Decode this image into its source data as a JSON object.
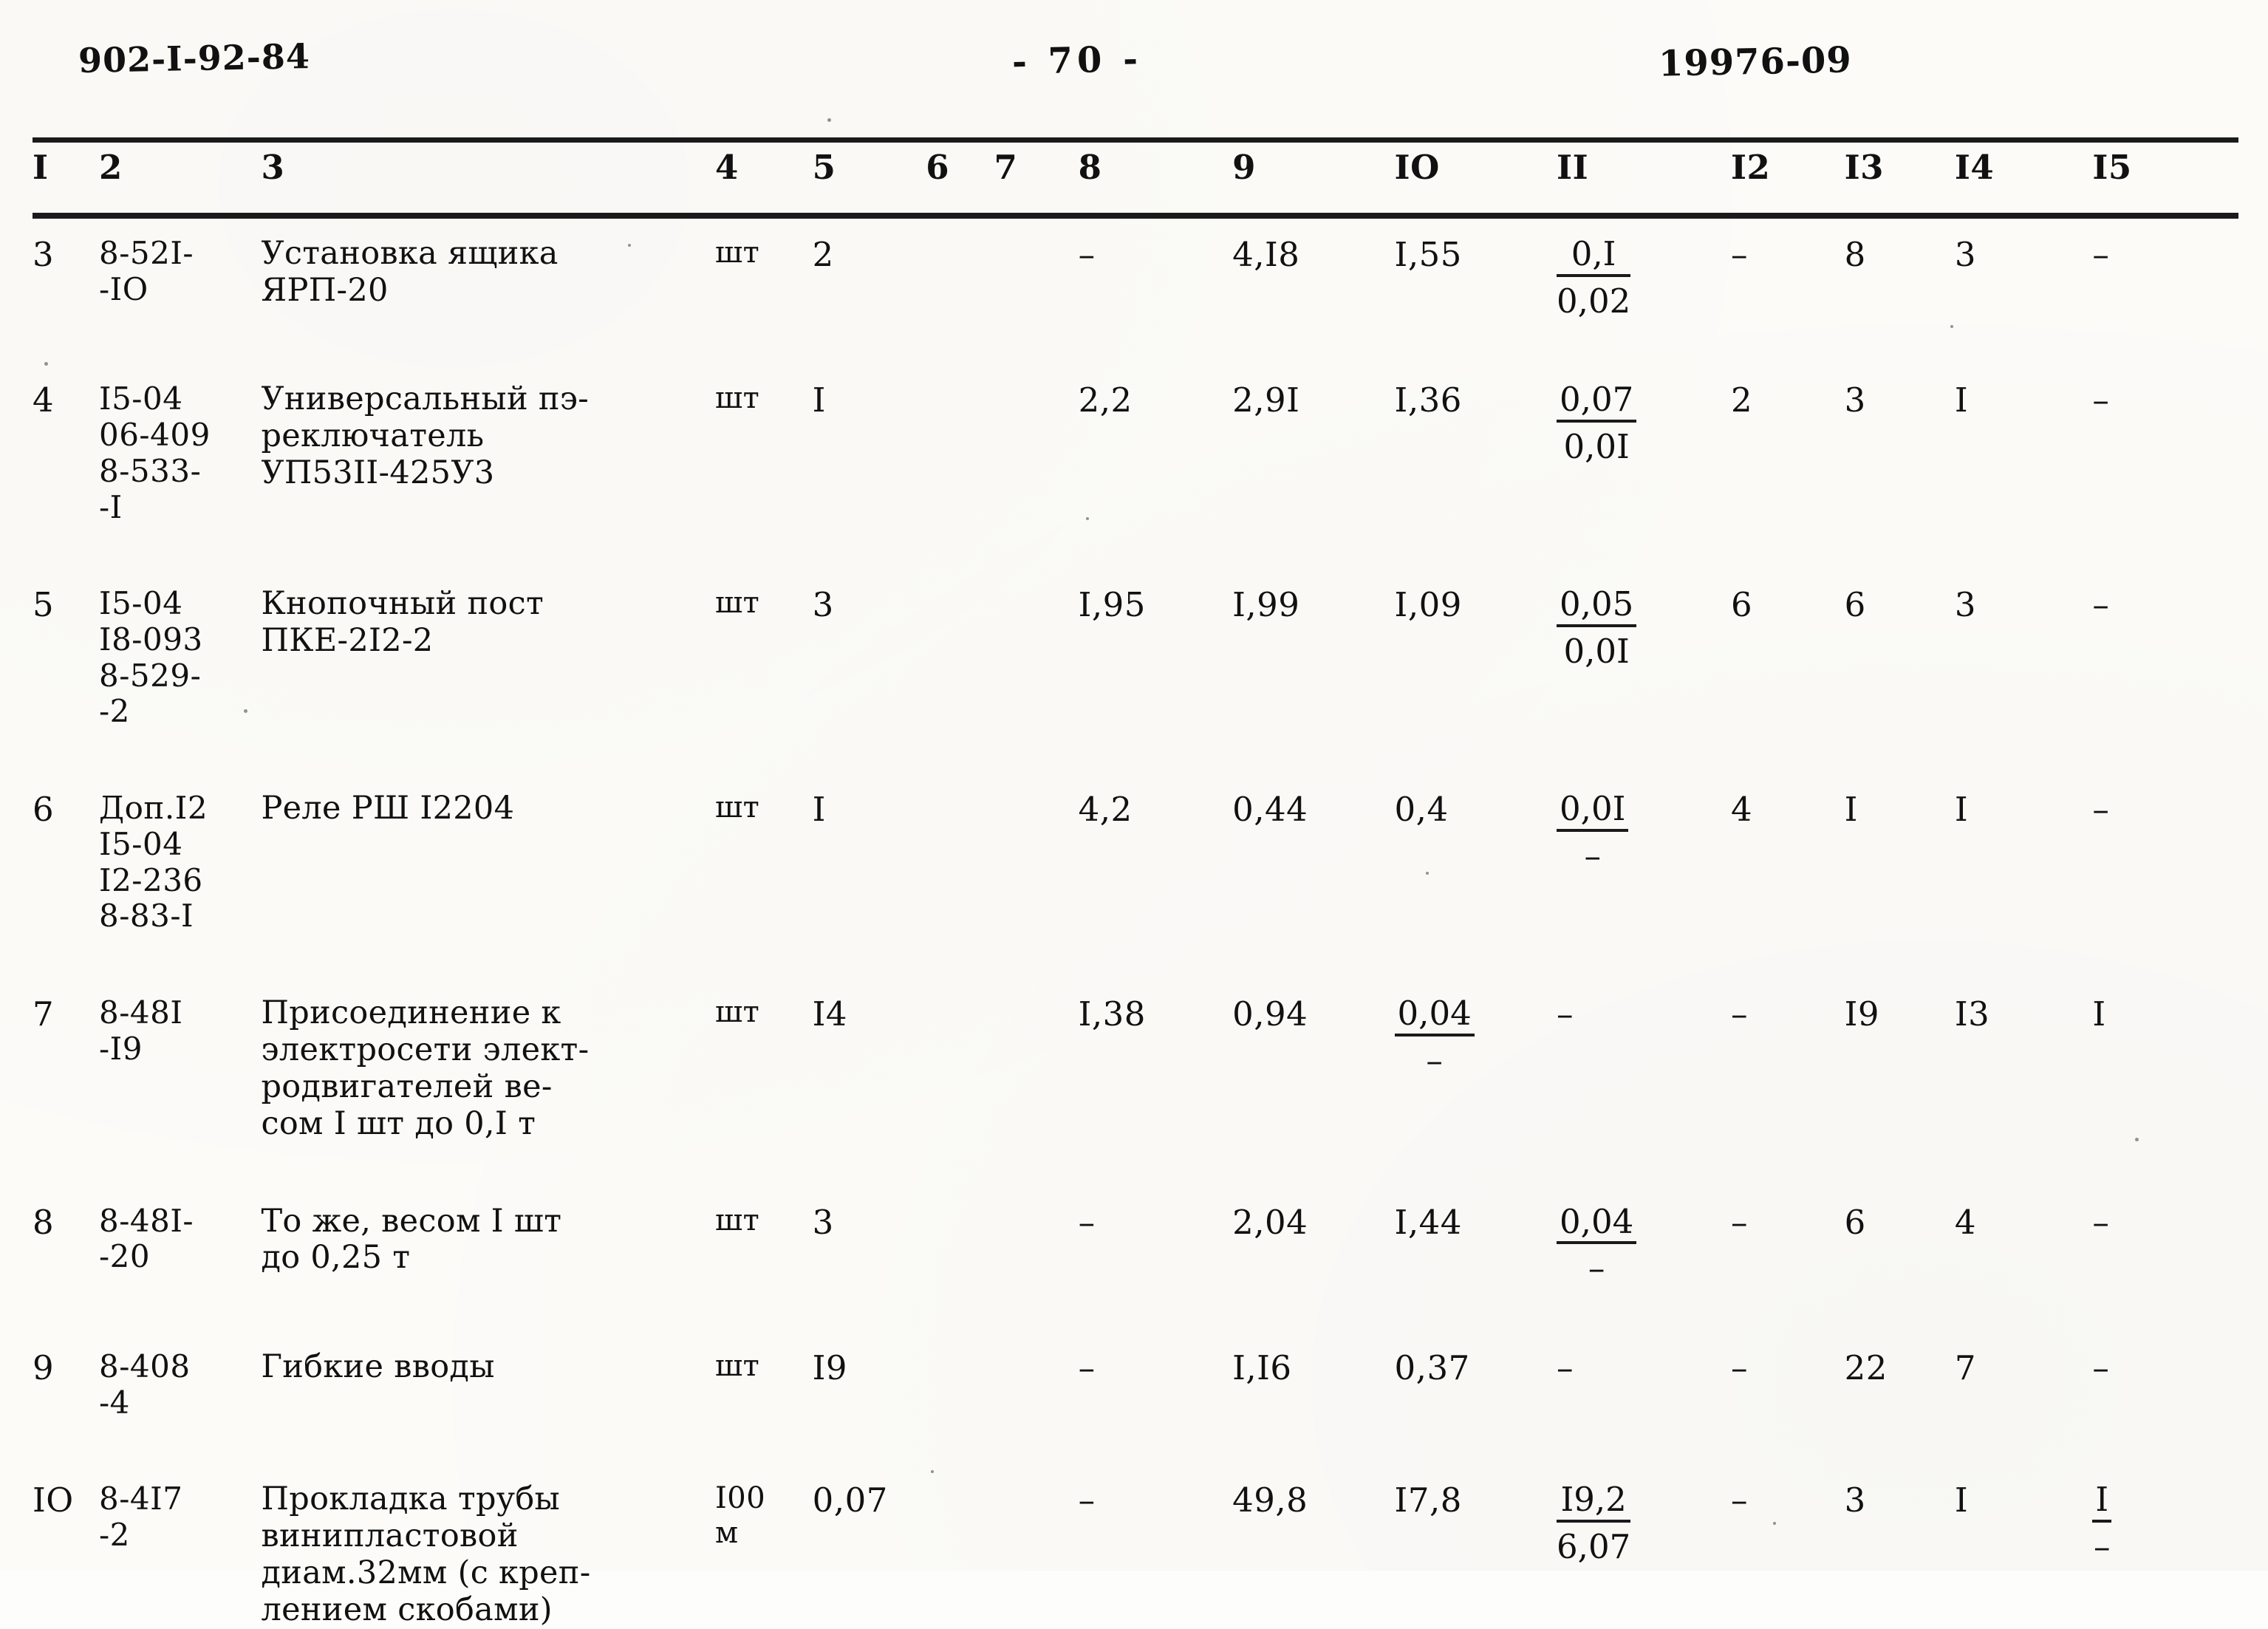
{
  "header": {
    "doc_number": "902-I-92-84",
    "page_marker": "- 70 -",
    "sheet_code": "19976-09"
  },
  "table": {
    "column_headers": [
      "I",
      "2",
      "3",
      "4",
      "5",
      "6",
      "7",
      "8",
      "9",
      "IO",
      "II",
      "I2",
      "I3",
      "I4",
      "I5"
    ],
    "rows": [
      {
        "pos": "3",
        "code": "8-52I-\n-IO",
        "name": "Установка ящика\nЯРП-20",
        "unit": "шт",
        "c5": "2",
        "c6": "",
        "c7": "",
        "c8": "–",
        "c9": "4,I8",
        "c10": "I,55",
        "c11_numer": "0,I",
        "c11_denom": "0,02",
        "c12": "–",
        "c13": "8",
        "c14": "3",
        "c15": "–"
      },
      {
        "pos": "4",
        "code": "I5-04\n06-409\n8-533-\n-I",
        "name": "Универсальный пэ-\nреключатель\nУП53II-425У3",
        "unit": "шт",
        "c5": "I",
        "c6": "",
        "c7": "",
        "c8": "2,2",
        "c9": "2,9I",
        "c10": "I,36",
        "c11_numer": "0,07",
        "c11_denom": "0,0I",
        "c12": "2",
        "c13": "3",
        "c14": "I",
        "c15": "–"
      },
      {
        "pos": "5",
        "code": "I5-04\nI8-093\n8-529-\n-2",
        "name": "Кнопочный пост\nПКЕ-2I2-2",
        "unit": "шт",
        "c5": "3",
        "c6": "",
        "c7": "",
        "c8": "I,95",
        "c9": "I,99",
        "c10": "I,09",
        "c11_numer": "0,05",
        "c11_denom": "0,0I",
        "c12": "6",
        "c13": "6",
        "c14": "3",
        "c15": "–"
      },
      {
        "pos": "6",
        "code": "Доп.I2\nI5-04\nI2-236\n8-83-I",
        "name": "Реле РШ I2204",
        "unit": "шт",
        "c5": "I",
        "c6": "",
        "c7": "",
        "c8": "4,2",
        "c9": "0,44",
        "c10": "0,4",
        "c11_numer": "0,0I",
        "c11_denom": "–",
        "c12": "4",
        "c13": "I",
        "c14": "I",
        "c15": "–"
      },
      {
        "pos": "7",
        "code": "8-48I\n-I9",
        "name": "Присоединение к\nэлектросети элект-\nродвигателей ве-\nсом I шт до 0,I т",
        "unit": "шт",
        "c5": "I4",
        "c6": "",
        "c7": "",
        "c8": "I,38",
        "c9": "0,94",
        "c10_numer": "0,04",
        "c10_denom": "–",
        "c11": "–",
        "c12": "–",
        "c13": "I9",
        "c14": "I3",
        "c15": "I"
      },
      {
        "pos": "8",
        "code": "8-48I-\n-20",
        "name": "То же, весом I шт\nдо 0,25 т",
        "unit": "шт",
        "c5": "3",
        "c6": "",
        "c7": "",
        "c8": "–",
        "c9": "2,04",
        "c10": "I,44",
        "c11_numer": "0,04",
        "c11_denom": "–",
        "c12": "–",
        "c13": "6",
        "c14": "4",
        "c15": "–"
      },
      {
        "pos": "9",
        "code": "8-408\n-4",
        "name": "Гибкие вводы",
        "unit": "шт",
        "c5": "I9",
        "c6": "",
        "c7": "",
        "c8": "–",
        "c9": "I,I6",
        "c10": "0,37",
        "c11": "–",
        "c12": "–",
        "c13": "22",
        "c14": "7",
        "c15": "–"
      },
      {
        "pos": "IO",
        "code": "8-4I7\n-2",
        "name": "Прокладка трубы\nвинипластовой\nдиам.32мм (с креп-\nлением скобами)",
        "unit": "I00\nм",
        "c5": "0,07",
        "c6": "",
        "c7": "",
        "c8": "–",
        "c9": "49,8",
        "c10": "I7,8",
        "c11_numer": "I9,2",
        "c11_denom": "6,07",
        "c12": "–",
        "c13": "3",
        "c14": "I",
        "c15_numer": "I",
        "c15_denom": "–"
      }
    ]
  }
}
